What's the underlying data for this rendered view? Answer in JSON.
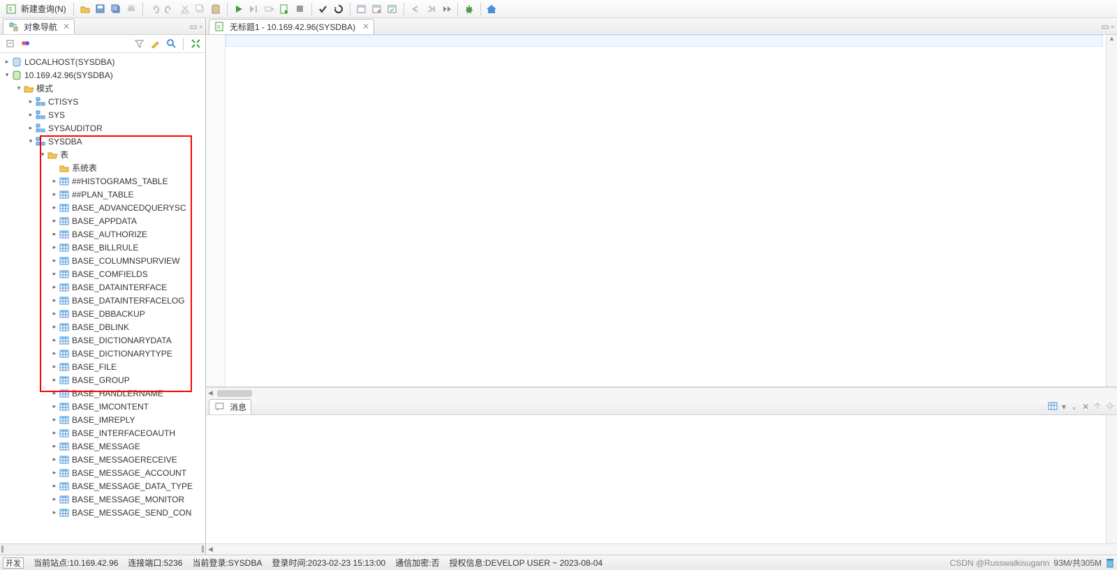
{
  "toolbar": {
    "new_query_label": "新建查询(N)"
  },
  "left": {
    "tab_title": "对象导航",
    "tree": {
      "root1": {
        "label": "LOCALHOST(SYSDBA)"
      },
      "root2": {
        "label": "10.169.42.96(SYSDBA)"
      },
      "schemas_label": "模式",
      "schema_items": [
        "CTISYS",
        "SYS",
        "SYSAUDITOR"
      ],
      "sysdba_label": "SYSDBA",
      "tables_label": "表",
      "system_tables_label": "系统表",
      "tables": [
        "##HISTOGRAMS_TABLE",
        "##PLAN_TABLE",
        "BASE_ADVANCEDQUERYSC",
        "BASE_APPDATA",
        "BASE_AUTHORIZE",
        "BASE_BILLRULE",
        "BASE_COLUMNSPURVIEW",
        "BASE_COMFIELDS",
        "BASE_DATAINTERFACE",
        "BASE_DATAINTERFACELOG",
        "BASE_DBBACKUP",
        "BASE_DBLINK",
        "BASE_DICTIONARYDATA",
        "BASE_DICTIONARYTYPE",
        "BASE_FILE",
        "BASE_GROUP",
        "BASE_HANDLERNAME",
        "BASE_IMCONTENT",
        "BASE_IMREPLY",
        "BASE_INTERFACEOAUTH",
        "BASE_MESSAGE",
        "BASE_MESSAGERECEIVE",
        "BASE_MESSAGE_ACCOUNT",
        "BASE_MESSAGE_DATA_TYPE",
        "BASE_MESSAGE_MONITOR",
        "BASE_MESSAGE_SEND_CON"
      ]
    }
  },
  "editor": {
    "tab_title": "无标题1 - 10.169.42.96(SYSDBA)"
  },
  "messages": {
    "tab_title": "消息"
  },
  "status": {
    "dev_btn": "开发",
    "site": "当前站点:10.169.42.96",
    "port": "连接端口:5236",
    "login": "当前登录:SYSDBA",
    "login_time": "登录时间:2023-02-23 15:13:00",
    "encrypt": "通信加密:否",
    "auth": "授权信息:DEVELOP USER ~ 2023-08-04",
    "watermark": "CSDN @Russwalkisugarin",
    "mem": "93M/共305M"
  },
  "colors": {
    "highlight_border": "#ff0000",
    "selection_bg": "#eef5ff"
  }
}
